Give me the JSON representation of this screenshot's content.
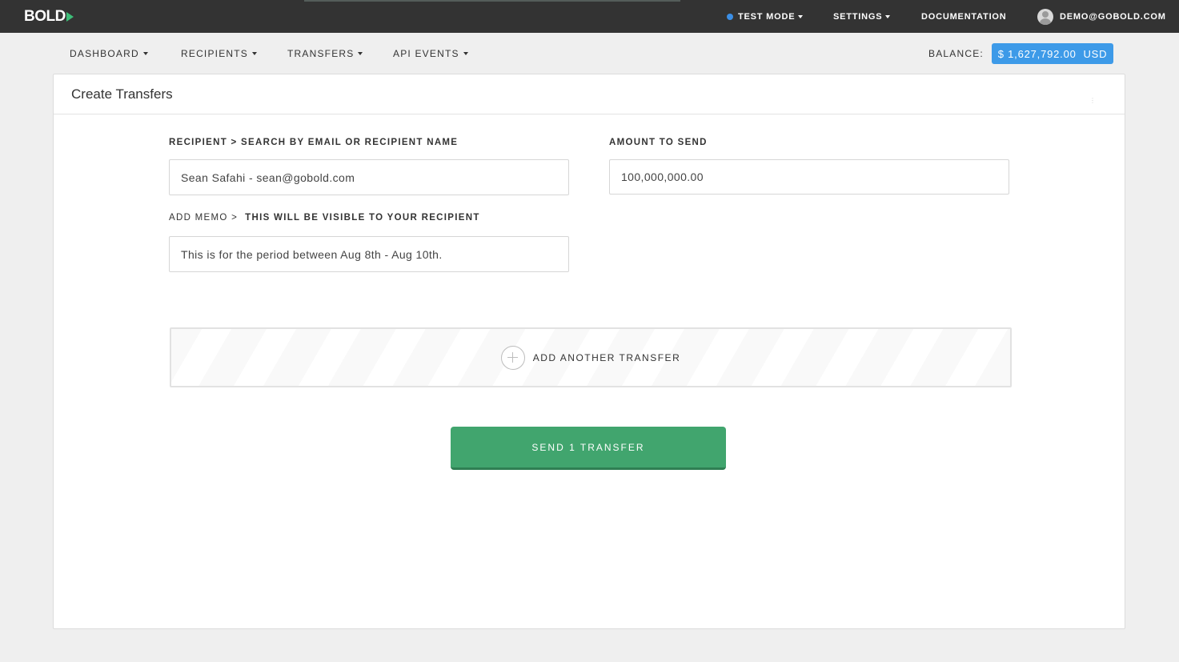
{
  "brand": {
    "name": "BOLD"
  },
  "topbar": {
    "test_mode": "TEST MODE",
    "settings": "SETTINGS",
    "documentation": "DOCUMENTATION",
    "user_email": "DEMO@GOBOLD.COM"
  },
  "subnav": {
    "items": [
      {
        "label": "DASHBOARD"
      },
      {
        "label": "RECIPIENTS"
      },
      {
        "label": "TRANSFERS"
      },
      {
        "label": "API EVENTS"
      }
    ],
    "balance_label": "BALANCE:",
    "balance_value": "$ 1,627,792.00  USD"
  },
  "panel": {
    "title": "Create Transfers",
    "recipient": {
      "label_prefix": "RECIPIENT > ",
      "label_rest": "SEARCH BY EMAIL OR RECIPIENT NAME",
      "value": "Sean Safahi - sean@gobold.com"
    },
    "amount": {
      "label": "AMOUNT TO SEND",
      "value": "100,000,000.00"
    },
    "memo": {
      "label_prefix": "ADD MEMO >  ",
      "label_rest": "THIS WILL BE VISIBLE TO YOUR RECIPIENT",
      "value": "This is for the period between Aug 8th - Aug 10th."
    },
    "add_another": "ADD ANOTHER TRANSFER",
    "send_button": "SEND 1 TRANSFER"
  },
  "colors": {
    "topbar": "#333333",
    "accent_blue": "#3d9ae8",
    "send_green": "#41a56e",
    "logo_green": "#3dbd78"
  }
}
